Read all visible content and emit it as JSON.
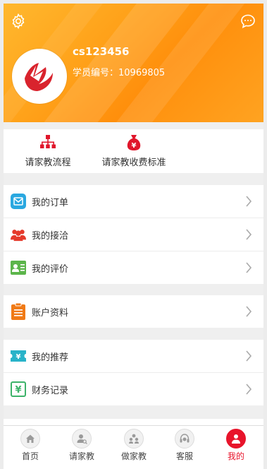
{
  "profile": {
    "username": "cs123456",
    "student_no": "学员编号：10969805"
  },
  "quick_actions": [
    {
      "label": "请家教流程",
      "icon": "flowchart-icon"
    },
    {
      "label": "请家教收费标准",
      "icon": "money-bag-icon"
    }
  ],
  "menu_groups": {
    "orders": [
      {
        "label": "我的订单",
        "icon": "mail-icon",
        "color": "#2aa8e0"
      },
      {
        "label": "我的接洽",
        "icon": "people-icon",
        "color": "#e53a2b"
      },
      {
        "label": "我的评价",
        "icon": "id-card-icon",
        "color": "#5cb54b"
      }
    ],
    "account": [
      {
        "label": "账户资料",
        "icon": "clipboard-icon",
        "color": "#f07a16"
      }
    ],
    "finance": [
      {
        "label": "我的推荐",
        "icon": "ticket-icon",
        "color": "#29b3c9"
      },
      {
        "label": "财务记录",
        "icon": "yen-icon",
        "color": "#3db36a"
      }
    ]
  },
  "tabs": [
    {
      "label": "首页",
      "icon": "home-icon"
    },
    {
      "label": "请家教",
      "icon": "search-person-icon"
    },
    {
      "label": "做家教",
      "icon": "group-icon"
    },
    {
      "label": "客服",
      "icon": "headset-icon"
    },
    {
      "label": "我的",
      "icon": "user-icon"
    }
  ],
  "colors": {
    "accent": "#ff9a16",
    "active_tab": "#e8142b"
  }
}
